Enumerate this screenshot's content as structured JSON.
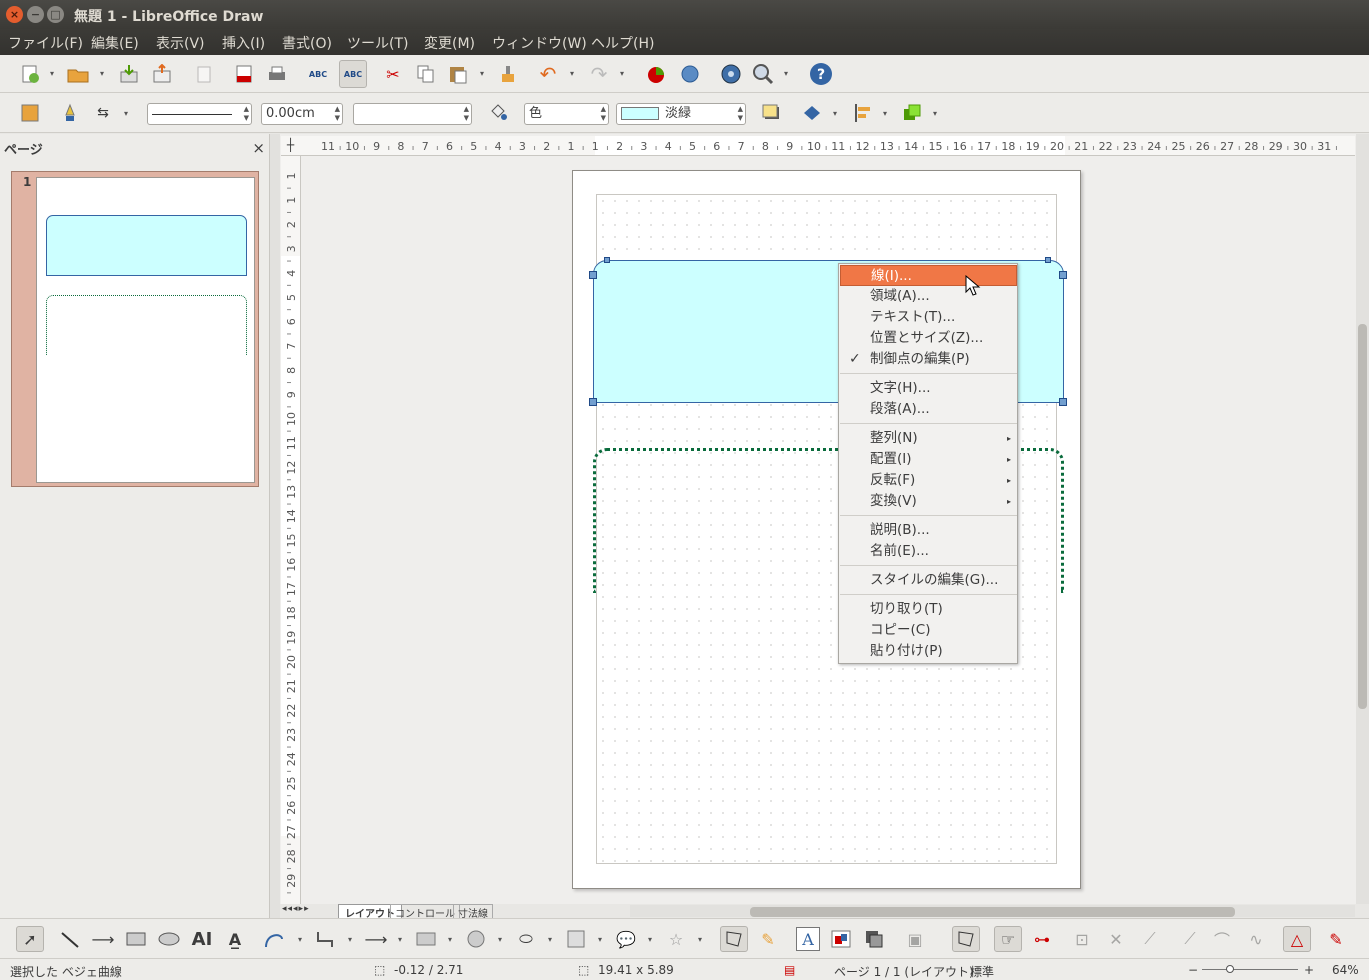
{
  "window": {
    "title": "無題 1 - LibreOffice Draw",
    "close_glyph": "×",
    "minimize_glyph": "−",
    "maximize_glyph": "□"
  },
  "menubar": [
    "ファイル(F)",
    "編集(E)",
    "表示(V)",
    "挿入(I)",
    "書式(O)",
    "ツール(T)",
    "変更(M)",
    "ウィンドウ(W)",
    "ヘルプ(H)"
  ],
  "toolbar2": {
    "line_width": "0.00cm",
    "area_style": "色",
    "area_color": "淡緑",
    "area_color_hex": "#ccffff"
  },
  "sidepanel": {
    "title": "ページ",
    "close": "×",
    "page_number": "1"
  },
  "ruler": {
    "h_ticks": [
      "11",
      "10",
      "9",
      "8",
      "7",
      "6",
      "5",
      "4",
      "3",
      "2",
      "1",
      "1",
      "2",
      "3",
      "4",
      "5",
      "6",
      "7",
      "8",
      "9",
      "10",
      "11",
      "12",
      "13",
      "14",
      "15",
      "16",
      "17",
      "18",
      "19",
      "20",
      "21",
      "22",
      "23",
      "24",
      "25",
      "26",
      "27",
      "28",
      "29",
      "30",
      "31"
    ],
    "v_ticks": [
      "1",
      "1",
      "2",
      "3",
      "4",
      "5",
      "6",
      "7",
      "8",
      "9",
      "10",
      "11",
      "12",
      "13",
      "14",
      "15",
      "16",
      "17",
      "18",
      "19",
      "20",
      "21",
      "22",
      "23",
      "24",
      "25",
      "26",
      "27",
      "28",
      "29"
    ]
  },
  "context_menu": {
    "groups": [
      [
        {
          "label": "線(I)..."
        },
        {
          "label": "領域(A)..."
        },
        {
          "label": "テキスト(T)..."
        },
        {
          "label": "位置とサイズ(Z)..."
        },
        {
          "label": "制御点の編集(P)",
          "checked": true
        }
      ],
      [
        {
          "label": "文字(H)..."
        },
        {
          "label": "段落(A)..."
        }
      ],
      [
        {
          "label": "整列(N)",
          "submenu": true
        },
        {
          "label": "配置(I)",
          "submenu": true
        },
        {
          "label": "反転(F)",
          "submenu": true
        },
        {
          "label": "変換(V)",
          "submenu": true
        }
      ],
      [
        {
          "label": "説明(B)..."
        },
        {
          "label": "名前(E)..."
        }
      ],
      [
        {
          "label": "スタイルの編集(G)..."
        }
      ],
      [
        {
          "label": "切り取り(T)"
        },
        {
          "label": "コピー(C)"
        },
        {
          "label": "貼り付け(P)"
        }
      ]
    ],
    "highlighted_index": 0,
    "check_glyph": "✓",
    "submenu_glyph": "▸"
  },
  "tabs": [
    "レイアウト",
    "コントロール",
    "寸法線"
  ],
  "statusbar": {
    "selection": "選択した ベジェ曲線",
    "position": "-0.12 / 2.71",
    "size": "19.41 x 5.89",
    "page": "ページ 1 / 1 (レイアウト)",
    "style": "標準",
    "zoom_minus": "−",
    "zoom_plus": "+",
    "zoom": "64%"
  },
  "colors": {
    "accent": "#f07746",
    "shape_fill": "#ccffff",
    "shape_border": "#3465a4",
    "dotted_line": "#0a6b3c"
  }
}
